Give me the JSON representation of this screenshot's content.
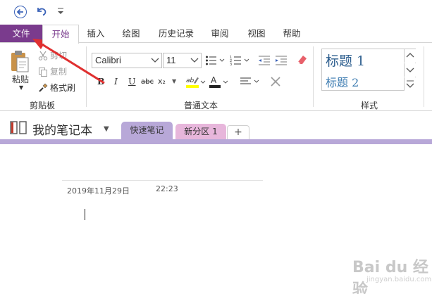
{
  "quick_access": {
    "back_icon": "back-circle-arrow-icon",
    "undo_icon": "undo-icon",
    "more_icon": "customize-dropdown-icon"
  },
  "tabs": {
    "file": "文件",
    "items": [
      "开始",
      "插入",
      "绘图",
      "历史记录",
      "审阅",
      "视图",
      "帮助"
    ]
  },
  "clipboard": {
    "paste": "粘贴",
    "cut": "剪切",
    "copy": "复制",
    "format_painter": "格式刷",
    "group_label": "剪贴板"
  },
  "basic_text": {
    "font_name": "Calibri",
    "font_size": "11",
    "bold": "B",
    "italic": "I",
    "underline": "U",
    "strike": "abc",
    "subscript": "x₂",
    "group_label": "普通文本"
  },
  "styles": {
    "heading1": "标题 1",
    "heading2": "标题 2",
    "group_label": "样式"
  },
  "notebook": {
    "title": "我的笔记本",
    "sections": [
      "快速笔记",
      "新分区 1"
    ],
    "add_label": "+"
  },
  "page": {
    "date": "2019年11月29日",
    "time": "22:23"
  },
  "watermark": {
    "main": "Bai du 经验",
    "sub": "jingyan.baidu.com"
  },
  "colors": {
    "file_tab": "#7a3b8d",
    "section1": "#b8a8d8",
    "section2": "#e7b6db",
    "annotation_arrow": "#e03030"
  }
}
